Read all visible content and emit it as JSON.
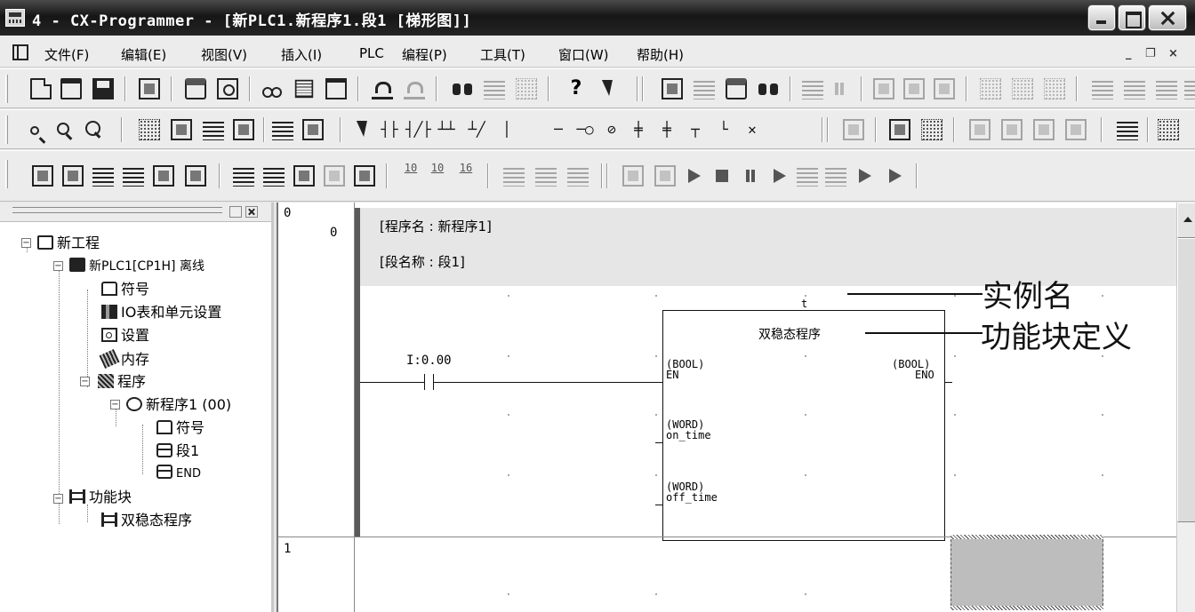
{
  "window": {
    "title": "4 - CX-Programmer - [新PLC1.新程序1.段1 [梯形图]]"
  },
  "menu": {
    "items": [
      "文件(F)",
      "编辑(E)",
      "视图(V)",
      "插入(I)",
      "PLC",
      "编程(P)",
      "工具(T)",
      "窗口(W)",
      "帮助(H)"
    ],
    "mdi_controls": [
      "_",
      "❐",
      "×"
    ]
  },
  "toolbar3": {
    "step_labels": [
      "10",
      "10",
      "16"
    ]
  },
  "tree": {
    "nodes": [
      {
        "label": "新工程",
        "icon": "project-network-icon"
      },
      {
        "label": "新PLC1[CP1H] 离线",
        "icon": "plc-icon"
      },
      {
        "label": "符号",
        "icon": "symbols-icon"
      },
      {
        "label": "IO表和单元设置",
        "icon": "io-table-icon"
      },
      {
        "label": "设置",
        "icon": "settings-icon"
      },
      {
        "label": "内存",
        "icon": "memory-icon"
      },
      {
        "label": "程序",
        "icon": "programs-icon"
      },
      {
        "label": "新程序1 (00)",
        "icon": "program-icon"
      },
      {
        "label": "符号",
        "icon": "local-symbols-icon"
      },
      {
        "label": "段1",
        "icon": "section-icon"
      },
      {
        "label": "END",
        "icon": "end-section-icon"
      },
      {
        "label": "功能块",
        "icon": "function-blocks-icon"
      },
      {
        "label": "双稳态程序",
        "icon": "function-block-icon"
      }
    ]
  },
  "ladder": {
    "rung0": {
      "rung_no": "0",
      "step": "0",
      "program_name_comment": "[程序名 : 新程序1]",
      "section_name_comment": "[段名称 : 段1]"
    },
    "rung1": {
      "rung_no": "1"
    },
    "contact": {
      "address": "I:0.00"
    },
    "function_block": {
      "instance_name": "t",
      "definition_name": "双稳态程序",
      "inputs": [
        {
          "type": "(BOOL)",
          "name": "EN"
        },
        {
          "type": "(WORD)",
          "name": "on_time"
        },
        {
          "type": "(WORD)",
          "name": "off_time"
        }
      ],
      "output": {
        "type": "(BOOL)",
        "name": "ENO"
      }
    },
    "annotations": {
      "instance_label": "实例名",
      "definition_label": "功能块定义"
    }
  },
  "colors": {
    "titlebar": "#1e1e1e",
    "rung_bar": "#5a5a5a",
    "comment_bg": "#e6e6e6",
    "cursor_cell": "#bdbdbd"
  }
}
